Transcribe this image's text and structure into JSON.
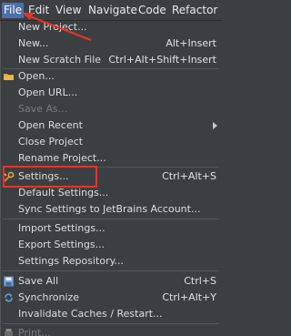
{
  "menubar": {
    "items": [
      {
        "label": "File",
        "active": true
      },
      {
        "label": "Edit"
      },
      {
        "label": "View"
      },
      {
        "label": "Navigate"
      },
      {
        "label": "Code"
      },
      {
        "label": "Refactor"
      }
    ]
  },
  "file_menu": {
    "items": [
      {
        "label": "New Project...",
        "shortcut": ""
      },
      {
        "label": "New...",
        "shortcut": "Alt+Insert"
      },
      {
        "label": "New Scratch File",
        "shortcut": "Ctrl+Alt+Shift+Insert"
      },
      {
        "label": "Open...",
        "shortcut": "",
        "icon": "folder-icon"
      },
      {
        "label": "Open URL...",
        "shortcut": ""
      },
      {
        "label": "Save As...",
        "shortcut": "",
        "disabled": true
      },
      {
        "label": "Open Recent",
        "shortcut": "",
        "submenu": true
      },
      {
        "label": "Close Project",
        "shortcut": ""
      },
      {
        "label": "Rename Project...",
        "shortcut": ""
      },
      {
        "label": "Settings...",
        "shortcut": "Ctrl+Alt+S",
        "icon": "wrench-icon"
      },
      {
        "label": "Default Settings...",
        "shortcut": ""
      },
      {
        "label": "Sync Settings to JetBrains Account...",
        "shortcut": ""
      },
      {
        "label": "Import Settings...",
        "shortcut": ""
      },
      {
        "label": "Export Settings...",
        "shortcut": ""
      },
      {
        "label": "Settings Repository...",
        "shortcut": ""
      },
      {
        "label": "Save All",
        "shortcut": "Ctrl+S",
        "icon": "save-icon"
      },
      {
        "label": "Synchronize",
        "shortcut": "Ctrl+Alt+Y",
        "icon": "sync-icon"
      },
      {
        "label": "Invalidate Caches / Restart...",
        "shortcut": ""
      },
      {
        "label": "Print...",
        "shortcut": "",
        "disabled": true,
        "icon": "print-icon"
      }
    ]
  },
  "colors": {
    "menu_bg": "#3c3f41",
    "active_bg": "#4b6eaf",
    "annotation_red": "#e8332a"
  }
}
